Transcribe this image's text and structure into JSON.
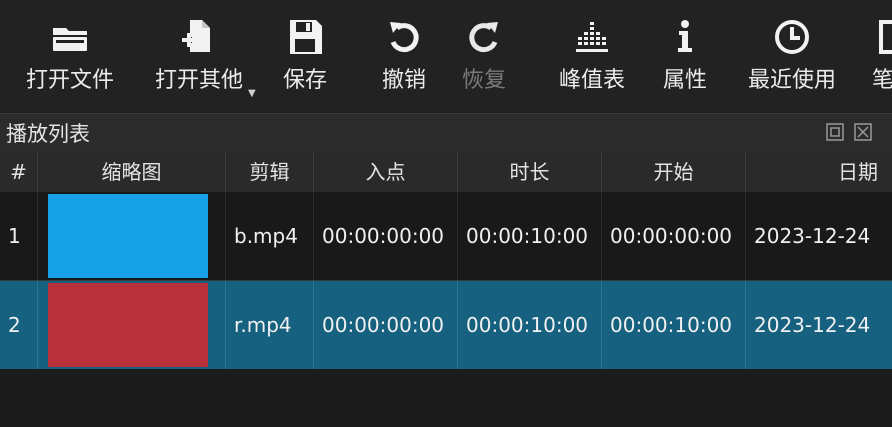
{
  "toolbar": {
    "buttons": [
      {
        "id": "open-file",
        "label": "打开文件",
        "icon": "folder-icon"
      },
      {
        "id": "open-other",
        "label": "打开其他",
        "icon": "add-file-icon"
      },
      {
        "id": "save",
        "label": "保存",
        "icon": "save-icon"
      },
      {
        "id": "undo",
        "label": "撤销",
        "icon": "undo-icon"
      },
      {
        "id": "redo",
        "label": "恢复",
        "icon": "redo-icon",
        "disabled": true
      },
      {
        "id": "peak-meter",
        "label": "峰值表",
        "icon": "meter-icon"
      },
      {
        "id": "properties",
        "label": "属性",
        "icon": "info-icon"
      },
      {
        "id": "recent",
        "label": "最近使用",
        "icon": "clock-icon"
      },
      {
        "id": "notes",
        "label": "笔",
        "icon": "notes-icon"
      }
    ]
  },
  "playlist": {
    "title": "播放列表",
    "columns": [
      "#",
      "缩略图",
      "剪辑",
      "入点",
      "时长",
      "开始",
      "日期"
    ],
    "rows": [
      {
        "index": "1",
        "thumb_color": "#17a1e6",
        "clip": "b.mp4",
        "in": "00:00:00:00",
        "duration": "00:00:10:00",
        "start": "00:00:00:00",
        "date": "2023-12-24"
      },
      {
        "index": "2",
        "thumb_color": "#b8313a",
        "clip": "r.mp4",
        "in": "00:00:00:00",
        "duration": "00:00:10:00",
        "start": "00:00:10:00",
        "date": "2023-12-24"
      }
    ]
  },
  "colors": {
    "selected_row": "#176180",
    "background": "#1e1e1e"
  }
}
